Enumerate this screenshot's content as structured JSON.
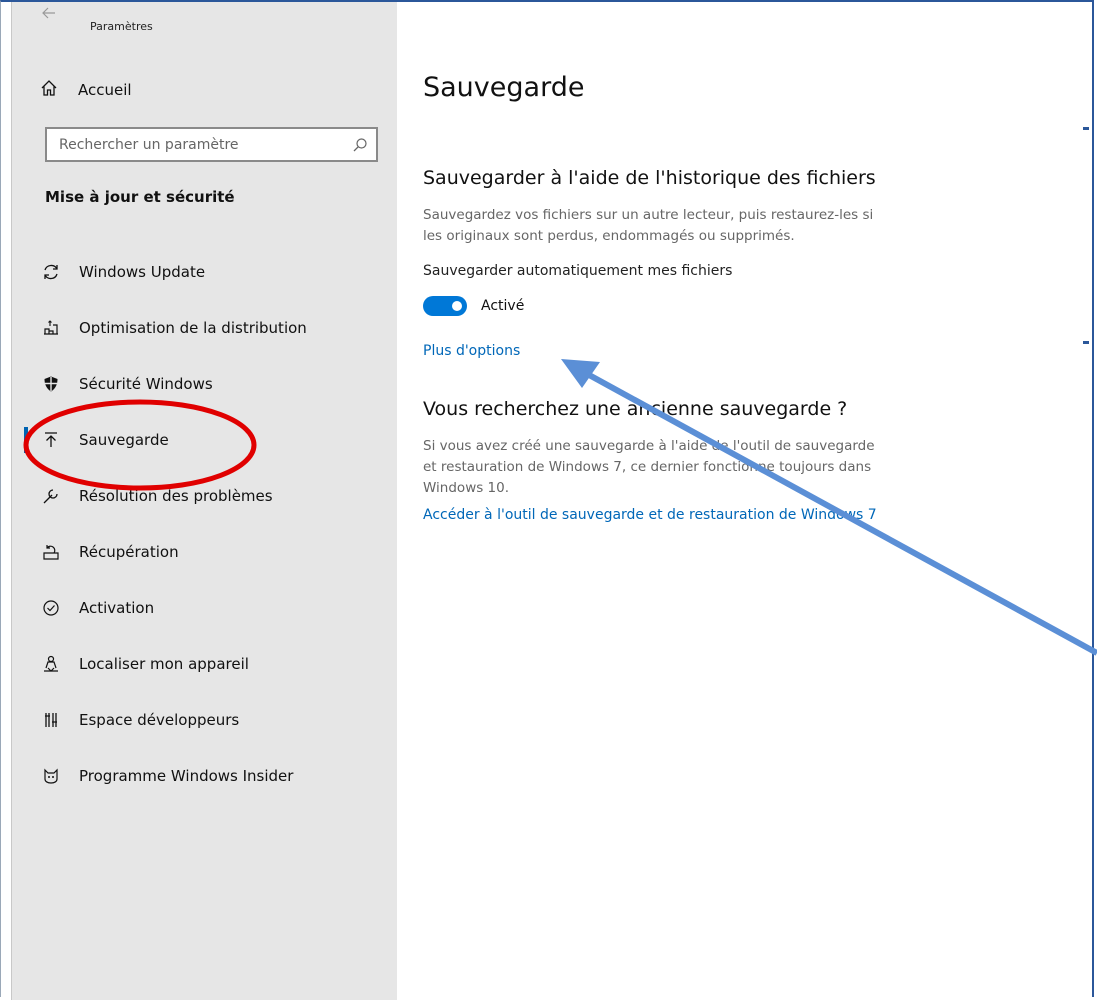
{
  "window": {
    "app_title": "Paramètres",
    "accent_color": "#0078d7",
    "frame_color": "#2b579a"
  },
  "sidebar": {
    "home_label": "Accueil",
    "search_placeholder": "Rechercher un paramètre",
    "section_title": "Mise à jour et sécurité",
    "items": [
      {
        "label": "Windows Update",
        "icon": "refresh-icon",
        "active": false
      },
      {
        "label": "Optimisation de la distribution",
        "icon": "delivery-optimization-icon",
        "active": false
      },
      {
        "label": "Sécurité Windows",
        "icon": "shield-icon",
        "active": false
      },
      {
        "label": "Sauvegarde",
        "icon": "upload-arrow-icon",
        "active": true
      },
      {
        "label": "Résolution des problèmes",
        "icon": "wrench-icon",
        "active": false
      },
      {
        "label": "Récupération",
        "icon": "recovery-icon",
        "active": false
      },
      {
        "label": "Activation",
        "icon": "check-circle-icon",
        "active": false
      },
      {
        "label": "Localiser mon appareil",
        "icon": "person-location-icon",
        "active": false
      },
      {
        "label": "Espace développeurs",
        "icon": "developer-tools-icon",
        "active": false
      },
      {
        "label": "Programme Windows Insider",
        "icon": "insider-cat-icon",
        "active": false
      }
    ]
  },
  "main": {
    "title": "Sauvegarde",
    "file_history": {
      "heading": "Sauvegarder à l'aide de l'historique des fichiers",
      "description_line1": "Sauvegardez vos fichiers sur un autre lecteur, puis restaurez-les si",
      "description_line2": "les originaux sont perdus, endommagés ou supprimés.",
      "auto_backup_label": "Sauvegarder automatiquement mes fichiers",
      "toggle_state": "Activé",
      "toggle_on": true,
      "more_options_link": "Plus d'options"
    },
    "old_backup": {
      "heading": "Vous recherchez une ancienne sauvegarde ?",
      "description_line1": "Si vous avez créé une sauvegarde à l'aide de l'outil de sauvegarde",
      "description_line2": "et restauration de Windows 7, ce dernier fonctionne toujours dans",
      "description_line3": "Windows 10.",
      "link": "Accéder à l'outil de sauvegarde et de restauration de Windows 7"
    }
  },
  "annotations": {
    "highlight_color": "#e00000",
    "arrow_color": "#5b8fd6"
  }
}
